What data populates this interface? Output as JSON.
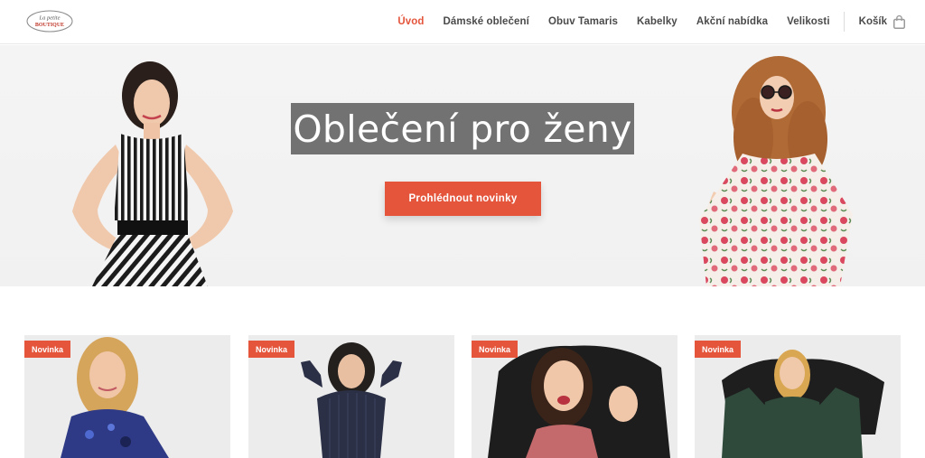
{
  "brand": {
    "logo_text_top": "La petite",
    "logo_text_bottom": "BOUTIQUE"
  },
  "nav": {
    "items": [
      {
        "label": "Úvod",
        "active": true
      },
      {
        "label": "Dámské oblečení",
        "active": false
      },
      {
        "label": "Obuv Tamaris",
        "active": false
      },
      {
        "label": "Kabelky",
        "active": false
      },
      {
        "label": "Akční nabídka",
        "active": false
      },
      {
        "label": "Velikosti",
        "active": false
      }
    ],
    "cart_label": "Košík",
    "cart_icon": "shopping-bag-icon"
  },
  "hero": {
    "title": "Oblečení pro ženy",
    "cta_label": "Prohlédnout novinky"
  },
  "products": [
    {
      "badge": "Novinka"
    },
    {
      "badge": "Novinka"
    },
    {
      "badge": "Novinka"
    },
    {
      "badge": "Novinka"
    }
  ],
  "colors": {
    "accent": "#e4553c",
    "nav_text": "#4a4a4a",
    "hero_bg": "#f3f3f3"
  }
}
